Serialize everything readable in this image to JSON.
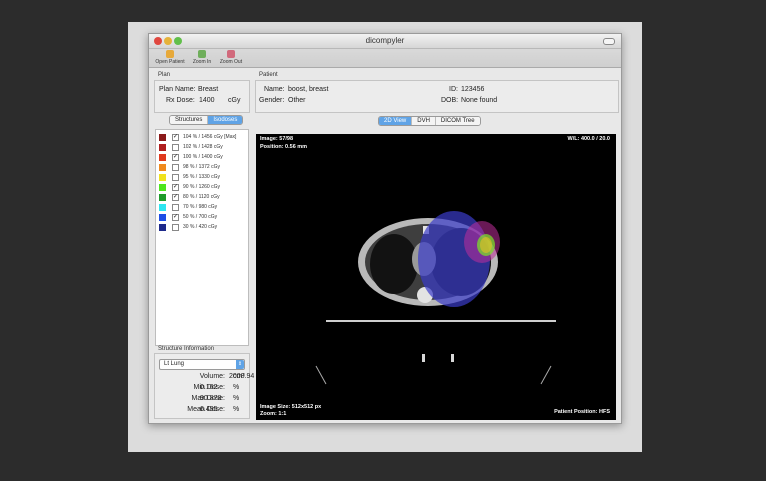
{
  "window": {
    "title": "dicompyler"
  },
  "toolbar": {
    "items": [
      {
        "label": "Open Patient",
        "icon": "folder-icon",
        "color": "#e7a93a"
      },
      {
        "label": "Zoom In",
        "icon": "zoom-in-icon",
        "color": "#6fae5b"
      },
      {
        "label": "Zoom Out",
        "icon": "zoom-out-icon",
        "color": "#d16a7c"
      }
    ]
  },
  "plan": {
    "group_label": "Plan",
    "name_label": "Plan Name:",
    "name_value": "Breast",
    "rx_label": "Rx Dose:",
    "rx_value": "1400",
    "rx_unit": "cGy"
  },
  "patient": {
    "group_label": "Patient",
    "name_label": "Name:",
    "name_value": "boost, breast",
    "gender_label": "Gender:",
    "gender_value": "Other",
    "id_label": "ID:",
    "id_value": "123456",
    "dob_label": "DOB:",
    "dob_value": "None found"
  },
  "left_tabs": [
    "Structures",
    "Isodoses"
  ],
  "isodoses": [
    {
      "label": "104 % / 1456 cGy [Max]",
      "color": "#8b1a1a",
      "checked": true
    },
    {
      "label": "102 % / 1428 cGy",
      "color": "#b01e1e",
      "checked": false
    },
    {
      "label": "100 % / 1400 cGy",
      "color": "#e03a1e",
      "checked": true
    },
    {
      "label": "98 % / 1372 cGy",
      "color": "#f08a1e",
      "checked": false
    },
    {
      "label": "95 % / 1330 cGy",
      "color": "#f0e21e",
      "checked": false
    },
    {
      "label": "90 % / 1260 cGy",
      "color": "#4ee61e",
      "checked": true
    },
    {
      "label": "80 % / 1120 cGy",
      "color": "#1e9b2a",
      "checked": true
    },
    {
      "label": "70 % / 980 cGy",
      "color": "#2ee6f0",
      "checked": false
    },
    {
      "label": "50 % / 700 cGy",
      "color": "#1e4ee6",
      "checked": true
    },
    {
      "label": "30 % / 420 cGy",
      "color": "#1e2a8b",
      "checked": false
    }
  ],
  "structure_info": {
    "group_label": "Structure Information",
    "selected": "Lt Lung",
    "volume_label": "Volume:",
    "volume_value": "2008.94",
    "volume_unit": "cm³",
    "min_label": "Min Dose:",
    "min_value": "0.162",
    "min_unit": "%",
    "max_label": "Max Dose:",
    "max_value": "90.878",
    "max_unit": "%",
    "mean_label": "Mean Dose:",
    "mean_value": "6.495",
    "mean_unit": "%"
  },
  "view_tabs": [
    "2D View",
    "DVH",
    "DICOM Tree"
  ],
  "viewer": {
    "image": "Image: 57/98",
    "position": "Position: 0.56 mm",
    "wl": "W/L: 400.0 / 20.0",
    "image_size": "Image Size: 512x512 px",
    "zoom": "Zoom: 1:1",
    "patient_position": "Patient Position: HFS"
  }
}
